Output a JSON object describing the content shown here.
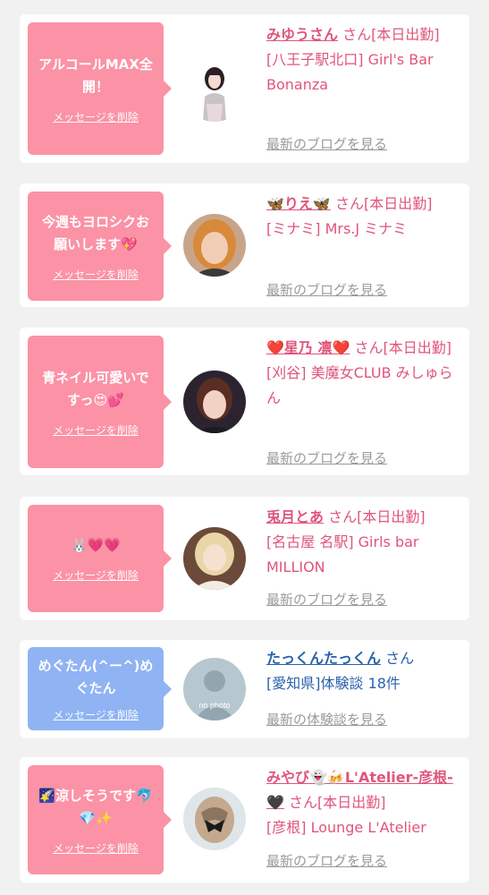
{
  "delete_label": "メッセージを削除",
  "san": "さん",
  "cards": [
    {
      "bubble_color": "#fb92a6",
      "message": "アルコールMAX全開！",
      "name": "みゆうさん",
      "status": "[本日出勤]",
      "shop": "[八王子駅北口] Girl's Bar Bonanza",
      "link": "最新のブログを見る",
      "avatar_icon": "woman-photo"
    },
    {
      "bubble_color": "#fb92a6",
      "message": "今週もヨロシクお願いします💖",
      "name": "🦋りえ🦋",
      "status": "[本日出勤]",
      "shop": "[ミナミ] Mrs.J ミナミ",
      "link": "最新のブログを見る",
      "avatar_icon": "woman-photo"
    },
    {
      "bubble_color": "#fb92a6",
      "message": "青ネイル可愛いですっ😍💕",
      "name": "❤️星乃 凛❤️",
      "status": "[本日出勤]",
      "shop": "[刈谷] 美魔女CLUB みしゅらん",
      "link": "最新のブログを見る",
      "avatar_icon": "woman-photo"
    },
    {
      "bubble_color": "#fb92a6",
      "message": "🐰💗💗",
      "name": "兎月とあ",
      "status": "[本日出勤]",
      "shop": "[名古屋 名駅] Girls bar MILLION",
      "link": "最新のブログを見る",
      "avatar_icon": "woman-photo"
    },
    {
      "bubble_color": "#8fb3f3",
      "message": "めぐたん(^ー^)めぐたん",
      "name": "たっくんたっくん",
      "status": "",
      "shop": "[愛知県]体験談 18件",
      "link": "最新の体験談を見る",
      "avatar_icon": "no-photo",
      "avatar_text": "no photo"
    },
    {
      "bubble_color": "#fb92a6",
      "message": "🌠涼しそうです🐬💎✨",
      "name": "みやび👻🍻L'Atelier-彦根-🖤",
      "status": "[本日出勤]",
      "shop": "[彦根] Lounge L'Atelier",
      "link": "最新のブログを見る",
      "avatar_icon": "woman-photo"
    }
  ]
}
